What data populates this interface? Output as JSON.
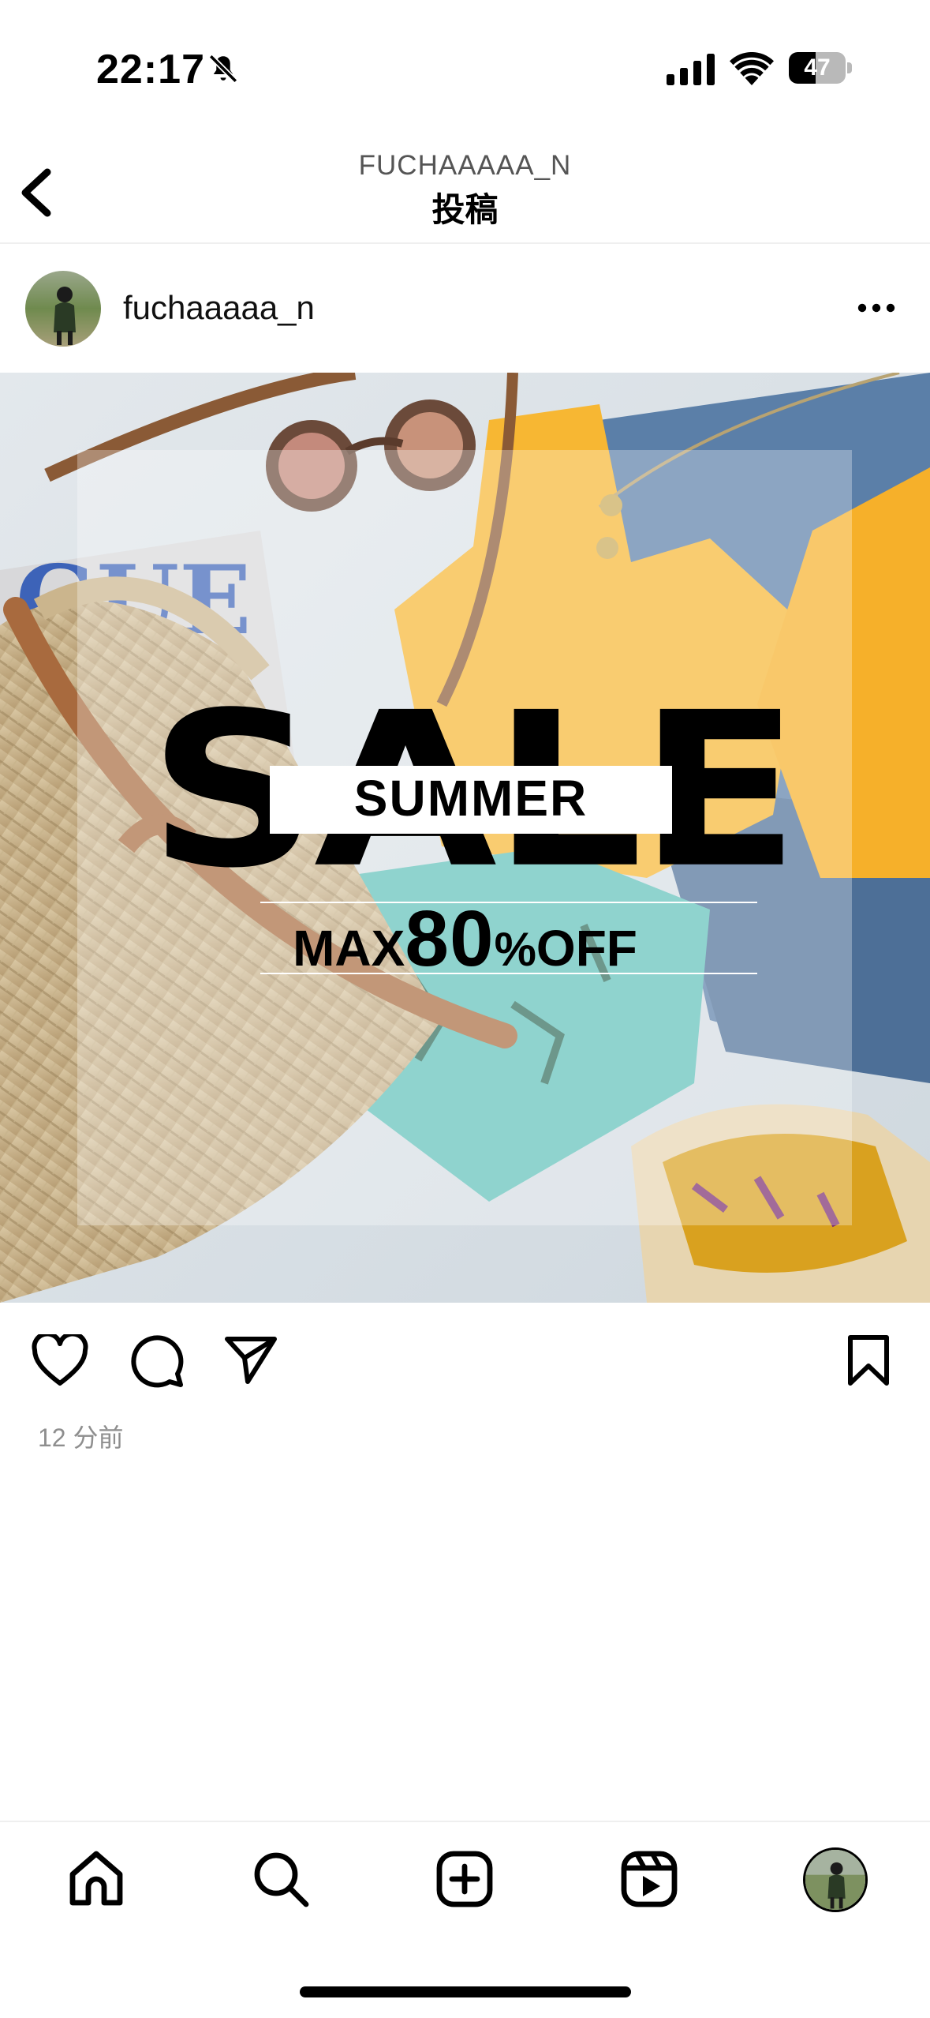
{
  "status_bar": {
    "time": "22:17",
    "battery_level": "47",
    "battery_fraction": 0.47,
    "icons": [
      "bell-slash-icon",
      "signal-icon",
      "wifi-icon",
      "battery-icon"
    ]
  },
  "header": {
    "account": "FUCHAAAAA_N",
    "title": "投稿",
    "back_icon": "chevron-left-icon"
  },
  "post": {
    "username": "fuchaaaaa_n",
    "more_icon": "ellipsis-icon",
    "image": {
      "sale": "SALE",
      "summer": "SUMMER",
      "max": "MAX",
      "discount": "80",
      "percent": "%",
      "off": "OFF"
    },
    "time_ago": "12 分前"
  },
  "actions": {
    "like_icon": "heart-icon",
    "comment_icon": "comment-icon",
    "share_icon": "send-icon",
    "save_icon": "bookmark-icon"
  },
  "tab_bar": {
    "items": [
      "home-icon",
      "search-icon",
      "create-icon",
      "reels-icon",
      "profile-avatar"
    ]
  },
  "colors": {
    "text_secondary": "#8e8e8e",
    "divider": "#efefef"
  }
}
